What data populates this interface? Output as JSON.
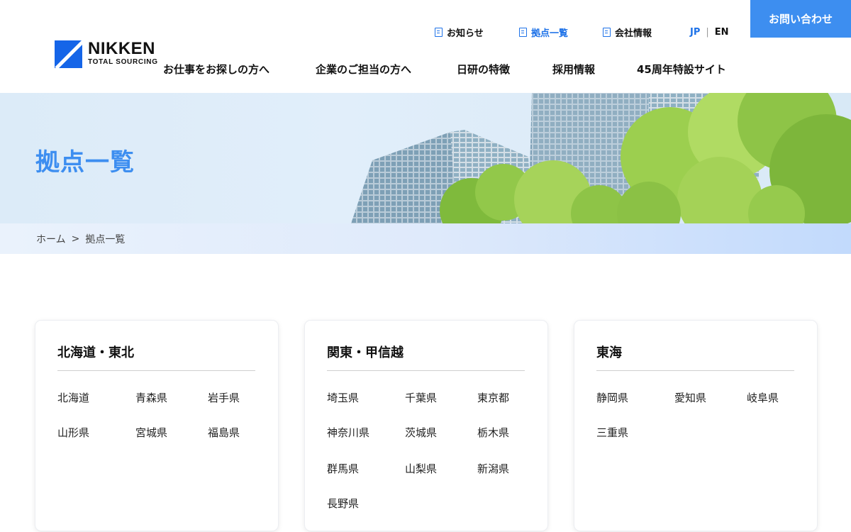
{
  "logo": {
    "name": "NIKKEN",
    "sub": "TOTAL SOURCING"
  },
  "utility_nav": [
    {
      "label": "お知らせ",
      "icon": "document-icon"
    },
    {
      "label": "拠点一覧",
      "icon": "building-icon",
      "active": true
    },
    {
      "label": "会社情報",
      "icon": "document-icon"
    }
  ],
  "lang": {
    "jp": "JP",
    "sep": "|",
    "en": "EN"
  },
  "contact": {
    "label": "お問い合わせ"
  },
  "main_nav": [
    "お仕事をお探しの方へ",
    "企業のご担当の方へ",
    "日研の特徴",
    "採用情報",
    "45周年特設サイト"
  ],
  "hero": {
    "title": "拠点一覧"
  },
  "breadcrumb": {
    "home": "ホーム",
    "sep": ">",
    "current": "拠点一覧"
  },
  "regions": [
    {
      "name": "北海道・東北",
      "prefectures": [
        "北海道",
        "青森県",
        "岩手県",
        "山形県",
        "宮城県",
        "福島県"
      ]
    },
    {
      "name": "関東・甲信越",
      "prefectures": [
        "埼玉県",
        "千葉県",
        "東京都",
        "神奈川県",
        "茨城県",
        "栃木県",
        "群馬県",
        "山梨県",
        "新潟県",
        "長野県"
      ]
    },
    {
      "name": "東海",
      "prefectures": [
        "静岡県",
        "愛知県",
        "岐阜県",
        "三重県"
      ]
    }
  ],
  "colors": {
    "accent": "#3d8ef0",
    "logo_blue": "#1565e8",
    "nav_active": "#1e72e8"
  }
}
